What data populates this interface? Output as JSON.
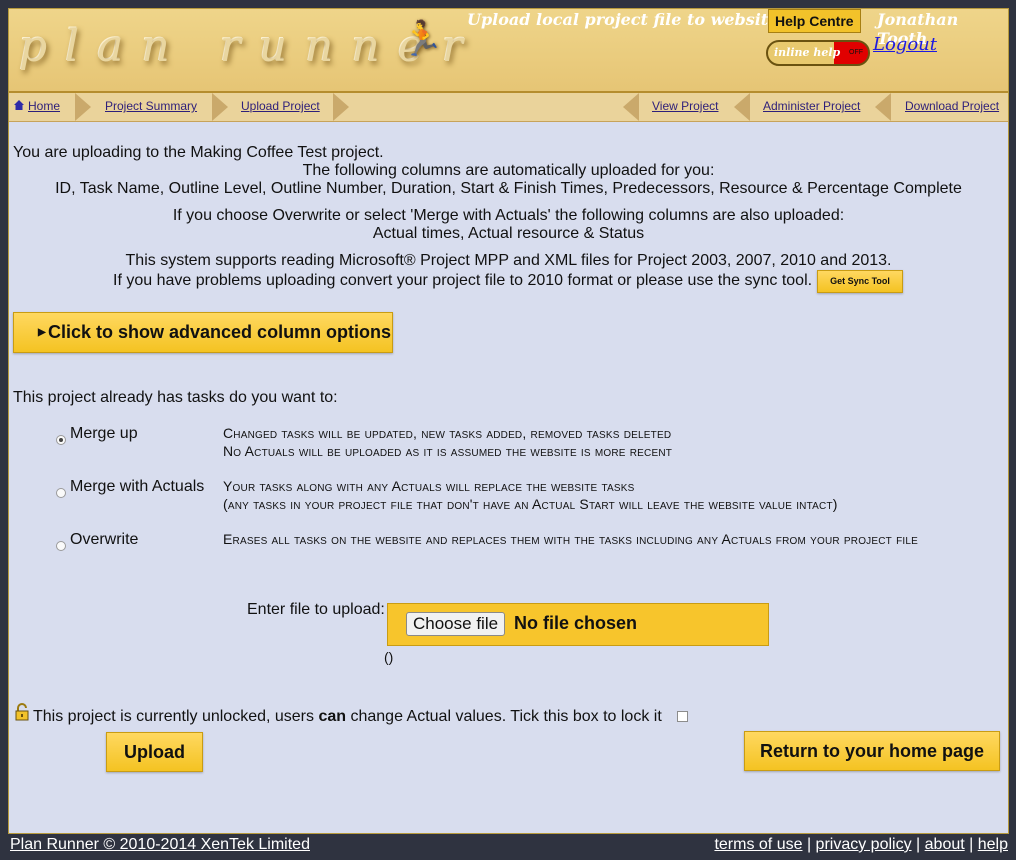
{
  "header": {
    "logo": "plan runner",
    "title": "Upload local project file to website",
    "help_centre": "Help Centre",
    "user_name": "Jonathan Tooth",
    "inline_help_label": "inline help",
    "inline_help_state": "OFF",
    "logout": "Logout"
  },
  "nav": {
    "home": "Home",
    "project_summary": "Project Summary",
    "upload_project": "Upload Project",
    "view_project": "View Project",
    "administer_project": "Administer Project",
    "download_project": "Download Project"
  },
  "intro": {
    "uploading_to": "You are uploading to the Making Coffee Test project.",
    "auto_columns_heading": "The following columns are automatically uploaded for you:",
    "auto_columns": "ID, Task Name, Outline Level, Outline Number, Duration, Start & Finish Times, Predecessors, Resource & Percentage Complete",
    "overwrite_heading": "If you choose Overwrite or select 'Merge with Actuals' the following columns are also uploaded:",
    "overwrite_columns": "Actual times, Actual resource & Status",
    "supports": "This system supports reading Microsoft® Project MPP and XML files for Project 2003, 2007, 2010 and 2013.",
    "problems": "If you have problems uploading convert your project file to 2010 format or please use the sync tool.",
    "sync_tool_button": "Get Sync Tool"
  },
  "advanced_button": "Click to show advanced column options",
  "options": {
    "question": "This project already has tasks do you want to:",
    "items": [
      {
        "label": "Merge up",
        "selected": true,
        "desc1": "Changed tasks will be updated, new tasks added, removed tasks deleted",
        "desc2": "No Actuals will be uploaded as it is assumed the website is more recent"
      },
      {
        "label": "Merge with Actuals",
        "selected": false,
        "desc1": "Your tasks along with any Actuals will replace the website tasks",
        "desc2": "(any tasks in your project file that don't have an Actual Start will leave the website value intact)"
      },
      {
        "label": "Overwrite",
        "selected": false,
        "desc1": "Erases all tasks on the website and replaces them with the tasks including any Actuals from your project file",
        "desc2": ""
      }
    ]
  },
  "upload": {
    "label": "Enter file to upload:",
    "choose_button": "Choose file",
    "no_file": "No file chosen",
    "parens": "()"
  },
  "lock": {
    "text_before": "This project is currently unlocked, users",
    "text_bold": "can",
    "text_after": "change Actual values.  Tick this box to lock it",
    "checked": false
  },
  "buttons": {
    "upload": "Upload",
    "return_home": "Return to your home page"
  },
  "footer": {
    "copyright": "Plan Runner © 2010-2014 XenTek Limited",
    "terms": "terms of use",
    "privacy": "privacy policy",
    "about": "about",
    "help": "help",
    "sep": "|"
  },
  "colors": {
    "accent_yellow": "#f4c322",
    "header_bg": "#e6c575",
    "content_bg": "#d8ddee",
    "toggle_off_red": "#e10000"
  }
}
